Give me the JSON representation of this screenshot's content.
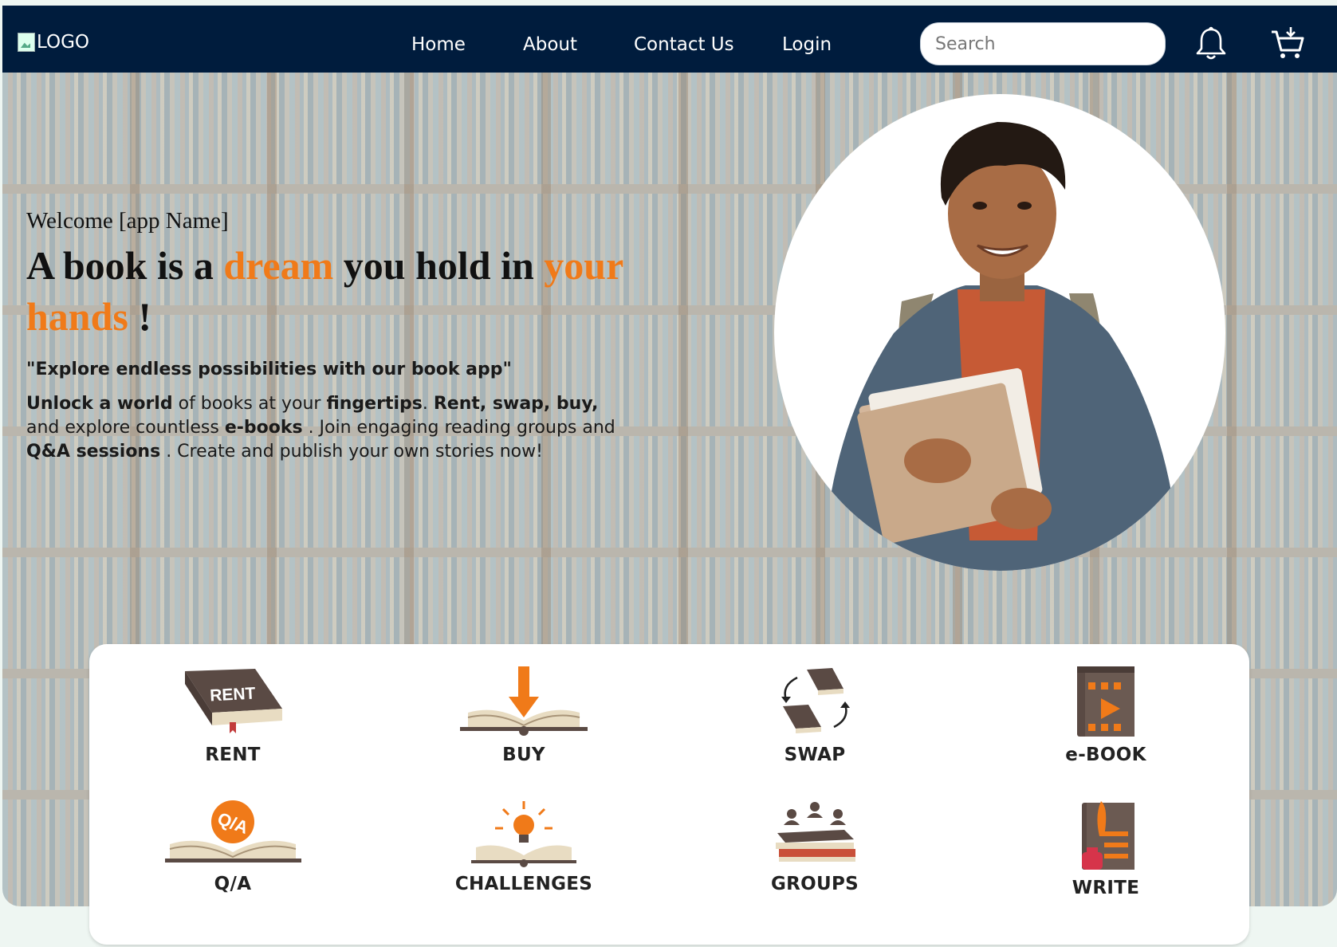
{
  "navbar": {
    "logo_alt": "LOGO",
    "links": [
      "Home",
      "About",
      "Contact Us",
      "Login"
    ],
    "search_placeholder": "Search"
  },
  "hero": {
    "welcome": "Welcome [app Name]",
    "headline": {
      "part1": "A book is a ",
      "highlight1": "dream",
      "part2": " you hold in ",
      "highlight2": "your hands",
      "part3": " !"
    },
    "quote": "\"Explore endless possibilities with our book app\"",
    "desc": {
      "s1": "Unlock a world",
      "s2": " of books at your ",
      "s3": "fingertips",
      "s4": ". ",
      "s5": "Rent, swap, buy,",
      "s6": " and explore countless ",
      "s7": "e-books",
      "s8": " . Join engaging reading groups and ",
      "s9": "Q&A sessions",
      "s10": " . Create and publish your own stories now!"
    }
  },
  "features": [
    {
      "label": "RENT",
      "icon": "rent-book-icon",
      "icon_text": "RENT"
    },
    {
      "label": "BUY",
      "icon": "buy-book-icon"
    },
    {
      "label": "SWAP",
      "icon": "swap-books-icon"
    },
    {
      "label": "e-BOOK",
      "icon": "ebook-icon"
    },
    {
      "label": "Q/A",
      "icon": "qa-book-icon",
      "icon_text": "Q/A"
    },
    {
      "label": "CHALLENGES",
      "icon": "challenges-bulb-icon"
    },
    {
      "label": "GROUPS",
      "icon": "groups-icon"
    },
    {
      "label": "WRITE",
      "icon": "write-book-icon"
    }
  ],
  "colors": {
    "navbar_bg": "#001c3d",
    "accent": "#f07a19",
    "icon_brown": "#5a4a44"
  }
}
